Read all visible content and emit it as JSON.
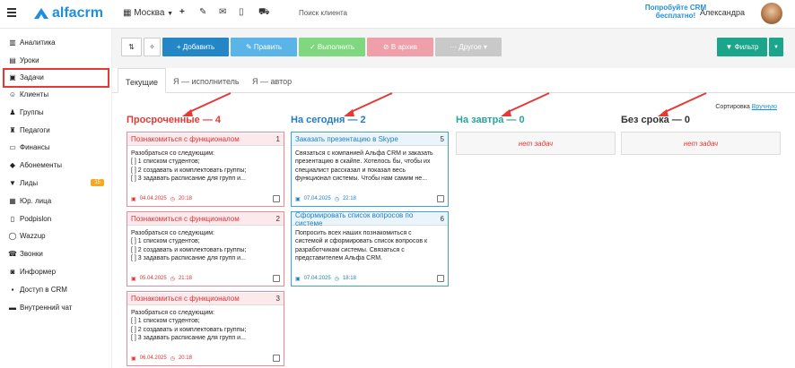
{
  "header": {
    "logo": "alfacrm",
    "city": "Москва",
    "search_placeholder": "Поиск клиента",
    "promo": "Попробуйте CRM бесплатно!",
    "user": "Александра"
  },
  "sidebar": {
    "items": [
      {
        "label": "Аналитика",
        "icon": "chart-icon"
      },
      {
        "label": "Уроки",
        "icon": "book-icon"
      },
      {
        "label": "Задачи",
        "icon": "clipboard-icon"
      },
      {
        "label": "Клиенты",
        "icon": "users-icon"
      },
      {
        "label": "Группы",
        "icon": "group-icon"
      },
      {
        "label": "Педагоги",
        "icon": "teacher-icon"
      },
      {
        "label": "Финансы",
        "icon": "money-icon"
      },
      {
        "label": "Абонементы",
        "icon": "tag-icon"
      },
      {
        "label": "Лиды",
        "icon": "funnel-icon",
        "badge": "15"
      },
      {
        "label": "Юр. лица",
        "icon": "building-icon"
      },
      {
        "label": "Podpislon",
        "icon": "doc-icon"
      },
      {
        "label": "Wazzup",
        "icon": "whatsapp-icon"
      },
      {
        "label": "Звонки",
        "icon": "phone-icon"
      },
      {
        "label": "Информер",
        "icon": "chat-icon"
      },
      {
        "label": "Доступ в CRM",
        "icon": "lock-icon"
      },
      {
        "label": "Внутренний чат",
        "icon": "message-icon"
      }
    ]
  },
  "toolbar": {
    "add": "+ Добавить",
    "edit": "✎ Править",
    "done": "✓ Выполнить",
    "archive": "⊘ В архив",
    "other": "··· Другое ▾",
    "filter": "▼ Фильтр"
  },
  "tabs": [
    "Текущие",
    "Я — исполнитель",
    "Я — автор"
  ],
  "sort": {
    "label": "Сортировка",
    "value": "Вручную"
  },
  "columns": [
    {
      "title": "Просроченные — 4",
      "color": "#e53935",
      "cards": [
        {
          "title": "Познакомиться с функционалом",
          "num": "1",
          "lines": [
            "Разобраться со следующим:",
            "[ ] 1 списком студентов;",
            "[ ] 2 создавать и комплектовать группы;",
            "[ ] 3 задавать расписание для групп и..."
          ],
          "date": "04.04.2025",
          "time": "20:18"
        },
        {
          "title": "Познакомиться с функционалом",
          "num": "2",
          "lines": [
            "Разобраться со следующим:",
            "[ ] 1 списком студентов;",
            "[ ] 2 создавать и комплектовать группы;",
            "[ ] 3 задавать расписание для групп и..."
          ],
          "date": "05.04.2025",
          "time": "21:18"
        },
        {
          "title": "Познакомиться с функционалом",
          "num": "3",
          "lines": [
            "Разобраться со следующим:",
            "[ ] 1 списком студентов;",
            "[ ] 2 создавать и комплектовать группы;",
            "[ ] 3 задавать расписание для групп и..."
          ],
          "date": "06.04.2025",
          "time": "20:18"
        }
      ]
    },
    {
      "title": "На сегодня — 2",
      "color": "#1f7dc4",
      "cards": [
        {
          "title": "Заказать презентацию в Skype",
          "num": "5",
          "lines": [
            "Связаться с компанией Альфа CRM и заказать",
            "презентацию в скайпе. Хотелось бы, чтобы их",
            "специалист рассказал и показал весь",
            "функционал системы. Чтобы нам самим не..."
          ],
          "date": "07.04.2025",
          "time": "22:18"
        },
        {
          "title": "Сформировать список вопросов по системе",
          "num": "6",
          "lines": [
            "Попросить всех наших познакомиться с",
            "системой и сформировать список вопросов к",
            "разработчикам системы. Связаться с",
            "представителем Альфа CRM."
          ],
          "date": "07.04.2025",
          "time": "18:18"
        }
      ]
    },
    {
      "title": "На завтра — 0",
      "color": "#26a69a",
      "empty": "нет задач"
    },
    {
      "title": "Без срока — 0",
      "color": "#333333",
      "empty": "нет задач"
    }
  ]
}
